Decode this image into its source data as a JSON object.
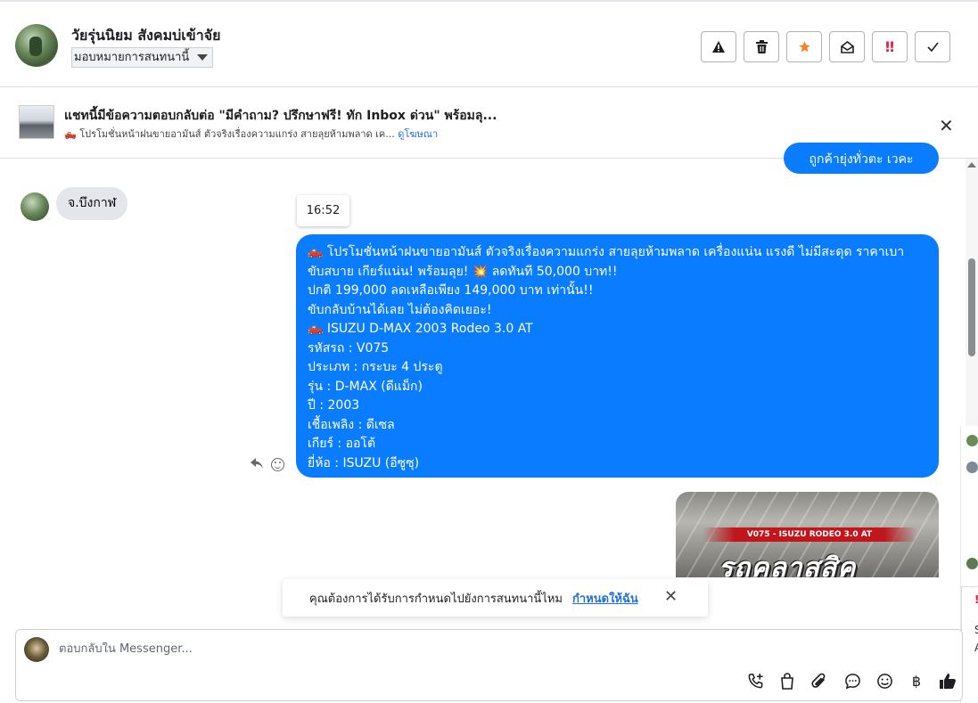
{
  "header": {
    "contact_name": "วัยรุ่นนิยม สังคมบ่เข้าจัย",
    "assign_label": "มอบหมายการสนทนานี้",
    "actions": [
      {
        "name": "spam-icon",
        "glyph": "⚠"
      },
      {
        "name": "trash-icon",
        "glyph": "🗑"
      },
      {
        "name": "star-icon",
        "glyph": "★"
      },
      {
        "name": "mark-unread-icon",
        "glyph": "✉"
      },
      {
        "name": "follow-up-icon",
        "glyph": "‼"
      },
      {
        "name": "done-icon",
        "glyph": "✓"
      }
    ]
  },
  "ad_banner": {
    "title": "แชทนี้มีข้อความตอบกลับต่อ \"มีคำถาม? ปรึกษาฟรี! ทัก Inbox ด่วน\" พร้อมลุ...",
    "subtitle": "🛻 โปรโมชั่นหน้าฝนขายอามันส์ ตัวจริงเรื่องความแกร่ง สายลุยห้ามพลาด เค...",
    "link": "ดูโฆษณา"
  },
  "conversation": {
    "partial_bubble": "ถูกค้ายุ่งทั่วตะ เวคะ",
    "their_message": "จ.บึงกาฬ",
    "timestamp": "16:52",
    "my_message_lines": [
      "🛻 โปรโมชั่นหน้าฝนขายอามันส์ ตัวจริงเรื่องความแกร่ง สายลุยห้ามพลาด เครื่องแน่น แรงดี ไม่มีสะดุด ราคาเบา ขับสบาย เกียร์แน่น! พร้อมลุย! 💥 ลดทันที 50,000 บาท!!",
      "ปกติ 199,000 ลดเหลือเพียง 149,000 บาท เท่านั้น!!",
      "ขับกลับบ้านได้เลย ไม่ต้องคิดเยอะ!",
      "🛻  ISUZU D-MAX 2003 Rodeo 3.0 AT",
      " รหัสรถ : V075",
      " ประเภท : กระบะ 4 ประตู",
      " รุ่น : D-MAX (ดีแม็ก)",
      " ปี : 2003",
      " เชื้อเพลิง : ดีเซล",
      " เกียร์ : ออโต้",
      " ยี่ห้อ : ISUZU (อีซูซุ)"
    ],
    "image_banner": "V075 - ISUZU RODEO 3.0 AT",
    "image_caption": "รถคลาสสิค"
  },
  "toast": {
    "text": "คุณต้องการได้รับการกำหนดไปยังการสนทนานี้ไหม",
    "link": "กำหนดให้ฉัน"
  },
  "side_strip": {
    "letters": [
      "S",
      "A"
    ]
  },
  "composer": {
    "placeholder": "ตอบกลับใน Messenger..."
  },
  "colors": {
    "accent": "#0a7cff",
    "link": "#216fdb",
    "like": "#1c1e21"
  }
}
